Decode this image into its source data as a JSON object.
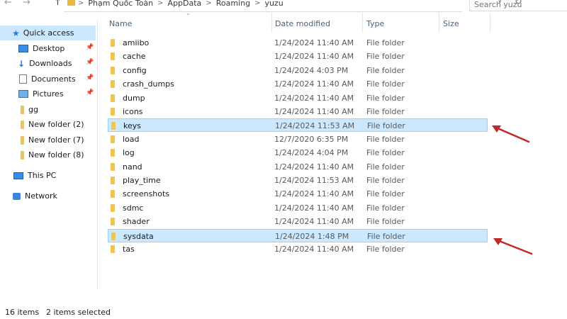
{
  "addressbar": {
    "back_icon": "←",
    "forward_icon": "→",
    "up_icon": "↑",
    "breadcrumbs": [
      "Phạm Quốc Toàn",
      "AppData",
      "Roaming",
      "yuzu"
    ],
    "search_placeholder": "Search yuzu"
  },
  "sidebar": {
    "items": [
      {
        "label": "Quick access",
        "icon": "star-icon",
        "active": true
      },
      {
        "label": "Desktop",
        "icon": "desktop-icon",
        "pinned": true
      },
      {
        "label": "Downloads",
        "icon": "download-icon",
        "pinned": true
      },
      {
        "label": "Documents",
        "icon": "document-icon",
        "pinned": true
      },
      {
        "label": "Pictures",
        "icon": "pictures-icon",
        "pinned": true
      },
      {
        "label": "gg",
        "icon": "folder-icon"
      },
      {
        "label": "New folder (2)",
        "icon": "folder-icon"
      },
      {
        "label": "New folder (7)",
        "icon": "folder-icon"
      },
      {
        "label": "New folder (8)",
        "icon": "folder-icon"
      },
      {
        "label": "This PC",
        "icon": "computer-icon"
      },
      {
        "label": "Network",
        "icon": "network-icon"
      }
    ]
  },
  "columns": {
    "name": "Name",
    "date": "Date modified",
    "type": "Type",
    "size": "Size"
  },
  "files": [
    {
      "name": "amiibo",
      "date": "1/24/2024 11:40 AM",
      "type": "File folder",
      "selected": false
    },
    {
      "name": "cache",
      "date": "1/24/2024 11:40 AM",
      "type": "File folder",
      "selected": false
    },
    {
      "name": "config",
      "date": "1/24/2024 4:03 PM",
      "type": "File folder",
      "selected": false
    },
    {
      "name": "crash_dumps",
      "date": "1/24/2024 11:40 AM",
      "type": "File folder",
      "selected": false
    },
    {
      "name": "dump",
      "date": "1/24/2024 11:40 AM",
      "type": "File folder",
      "selected": false
    },
    {
      "name": "icons",
      "date": "1/24/2024 11:40 AM",
      "type": "File folder",
      "selected": false
    },
    {
      "name": "keys",
      "date": "1/24/2024 11:53 AM",
      "type": "File folder",
      "selected": true
    },
    {
      "name": "load",
      "date": "12/7/2020 6:35 PM",
      "type": "File folder",
      "selected": false
    },
    {
      "name": "log",
      "date": "1/24/2024 4:04 PM",
      "type": "File folder",
      "selected": false
    },
    {
      "name": "nand",
      "date": "1/24/2024 11:40 AM",
      "type": "File folder",
      "selected": false
    },
    {
      "name": "play_time",
      "date": "1/24/2024 11:53 AM",
      "type": "File folder",
      "selected": false
    },
    {
      "name": "screenshots",
      "date": "1/24/2024 11:40 AM",
      "type": "File folder",
      "selected": false
    },
    {
      "name": "sdmc",
      "date": "1/24/2024 11:40 AM",
      "type": "File folder",
      "selected": false
    },
    {
      "name": "shader",
      "date": "1/24/2024 11:40 AM",
      "type": "File folder",
      "selected": false
    },
    {
      "name": "sysdata",
      "date": "1/24/2024 1:48 PM",
      "type": "File folder",
      "selected": true
    },
    {
      "name": "tas",
      "date": "1/24/2024 11:40 AM",
      "type": "File folder",
      "selected": false
    }
  ],
  "status": {
    "count": "16 items",
    "selection": "2 items selected"
  },
  "colors": {
    "selection_bg": "#cce8ff",
    "selection_border": "#99d1ff",
    "folder": "#f0c44d",
    "annotation_arrow": "#c0282a"
  }
}
